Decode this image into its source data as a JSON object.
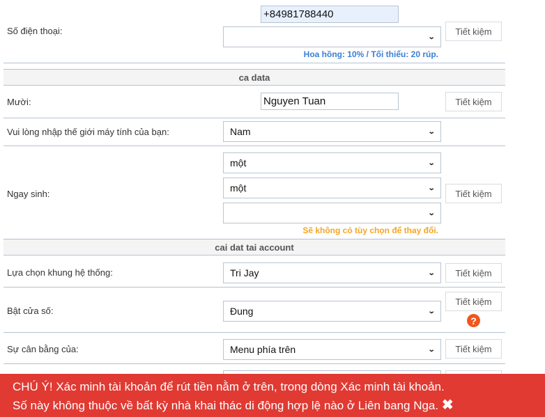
{
  "phone": {
    "label": "Số điện thoại:",
    "value": "+84981788440",
    "select_value": "",
    "save": "Tiết kiệm",
    "note": "Hoa hồng: 10% / Tối thiểu: 20 rúp.",
    "note_color": "#3a7fd5"
  },
  "section1": {
    "title": "ca data"
  },
  "name": {
    "label": "Mười:",
    "value": "Nguyen Tuan",
    "save": "Tiết kiệm"
  },
  "gender": {
    "label": "Vui lòng nhập thế giới máy tính của bạn:",
    "value": "Nam"
  },
  "birthday": {
    "label": "Ngay sinh:",
    "day": "một",
    "month": "một",
    "year": "",
    "save": "Tiết kiệm",
    "note": "Sẽ không có tùy chọn để thay đổi.",
    "note_color": "#f5a623"
  },
  "section2": {
    "title": "cai dat tai account"
  },
  "system": {
    "label": "Lựa chọn khung hệ thống:",
    "value": "Tri Jay",
    "save": "Tiết kiệm"
  },
  "window": {
    "label": "Bật cửa số:",
    "value": "Đung",
    "save": "Tiết kiệm",
    "help": "?"
  },
  "balance": {
    "label": "Sự cân bằng của:",
    "value": "Menu phía trên",
    "save": "Tiết kiệm"
  },
  "banner": {
    "line1": "CHÚ Ý! Xác minh tài khoản để rút tiền nằm ở trên, trong dòng Xác minh tài khoản.",
    "line2": "Số này không thuộc về bất kỳ nhà khai thác di động hợp lệ nào ở Liên bang Nga.",
    "close": "✖",
    "color": "#e03a33"
  }
}
